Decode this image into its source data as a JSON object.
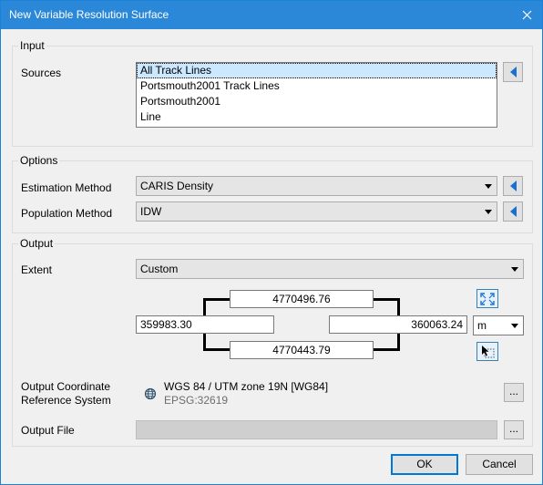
{
  "window": {
    "title": "New Variable Resolution Surface"
  },
  "input": {
    "legend": "Input",
    "sources_label": "Sources",
    "sources": [
      "All Track Lines",
      "Portsmouth2001 Track Lines",
      "Portsmouth2001",
      "Line"
    ]
  },
  "options": {
    "legend": "Options",
    "estimation_label": "Estimation Method",
    "estimation_value": "CARIS Density",
    "population_label": "Population Method",
    "population_value": "IDW"
  },
  "output": {
    "legend": "Output",
    "extent_label": "Extent",
    "extent_value": "Custom",
    "north": "4770496.76",
    "south": "4770443.79",
    "west": "359983.30",
    "east": "360063.24",
    "unit": "m",
    "crs_label_line1": "Output Coordinate",
    "crs_label_line2": "Reference System",
    "crs_name": "WGS 84 / UTM zone 19N [WG84]",
    "crs_code": "EPSG:32619",
    "file_label": "Output File",
    "ellipsis": "..."
  },
  "buttons": {
    "ok": "OK",
    "cancel": "Cancel"
  },
  "colors": {
    "titlebar": "#2b88d8",
    "accent": "#1a6fd0",
    "selection": "#cce8ff"
  }
}
